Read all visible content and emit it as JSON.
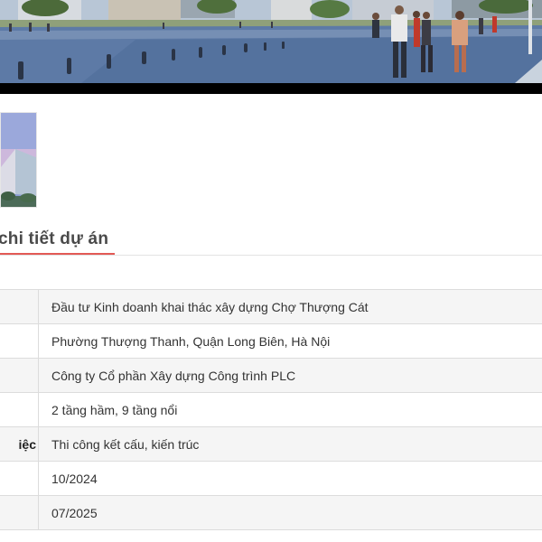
{
  "detail": {
    "heading": "chi tiết dự án",
    "accent_color": "#e25a55",
    "rows": [
      {
        "label": "",
        "value": "Đầu tư Kinh doanh khai thác xây dựng Chợ Thượng Cát"
      },
      {
        "label": "",
        "value": "Phường Thượng Thanh, Quận Long Biên, Hà Nội"
      },
      {
        "label": "",
        "value": "Công ty Cổ phần Xây dựng Công trình PLC"
      },
      {
        "label": "",
        "value": "2 tầng hầm, 9 tầng nổi"
      },
      {
        "label": "iệc",
        "value": "Thi công kết cấu, kiến trúc"
      },
      {
        "label": "",
        "value": "10/2024"
      },
      {
        "label": "",
        "value": "07/2025"
      }
    ]
  }
}
